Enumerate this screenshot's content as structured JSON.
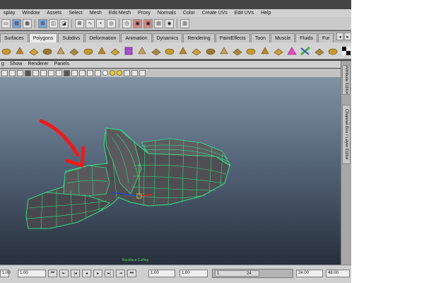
{
  "menubar": {
    "items": [
      "splay",
      "Window",
      "Assets",
      "Select",
      "Mesh",
      "Edit Mesh",
      "Proxy",
      "Normals",
      "Color",
      "Create UVs",
      "Edit UVs",
      "Help"
    ]
  },
  "status_toolbar": {
    "icons": [
      "new-scene-icon",
      "open-scene-icon",
      "save-scene-icon",
      "select-hierarchy-icon",
      "select-object-icon",
      "select-component-icon",
      "snap-grid-icon",
      "snap-curve-icon",
      "snap-point-icon",
      "snap-surface-icon",
      "history-icon",
      "render-icon",
      "ipr-render-icon",
      "render-settings-icon",
      "hypershade-icon",
      "sidebar-toggle-icon"
    ]
  },
  "shelf": {
    "tabs": [
      "Surfaces",
      "Polygons",
      "Subdivs",
      "Deformation",
      "Animation",
      "Dynamics",
      "Rendering",
      "PaintEffects",
      "Toon",
      "Muscle",
      "Fluids",
      "Fur"
    ],
    "active_tab": "Polygons",
    "scroll_prev": "◂",
    "scroll_next": "▸",
    "icons": [
      "poly-sphere-icon",
      "poly-cube-icon",
      "poly-cylinder-icon",
      "poly-cone-icon",
      "poly-plane-icon",
      "poly-torus-icon",
      "combine-icon",
      "separate-icon",
      "extract-icon",
      "smooth-icon",
      "boolean-icon",
      "mirror-icon",
      "extrude-icon",
      "bridge-icon",
      "append-icon",
      "split-polygon-icon",
      "insert-edge-loop-icon",
      "offset-edge-loop-icon",
      "merge-vertices-icon",
      "bevel-icon",
      "fill-hole-icon",
      "reduce-icon",
      "smooth-proxy-icon",
      "cleanup-icon",
      "triangulate-icon",
      "uv-checker-icon"
    ]
  },
  "panel": {
    "menus": [
      "g",
      "Show",
      "Renderer",
      "Panels"
    ]
  },
  "viewport": {
    "caption": "Backface Culling",
    "annotation_color": "#ee1a1a",
    "wire_color": "#32e58c"
  },
  "right_tabs": {
    "attribute_editor": "Attribute Editor",
    "channel_box": "Channel Box / Layer Editor"
  },
  "timeslider": {
    "left_field": "1.00",
    "current_field": "1.00",
    "start_field": "1.00",
    "range_start": "1",
    "range_end": "24",
    "end_field": "24.00",
    "max_field": "48.00",
    "buttons": [
      "⏮",
      "⇤",
      "|◂",
      "◂",
      "▸",
      "▸|",
      "⇥",
      "⏭"
    ]
  }
}
